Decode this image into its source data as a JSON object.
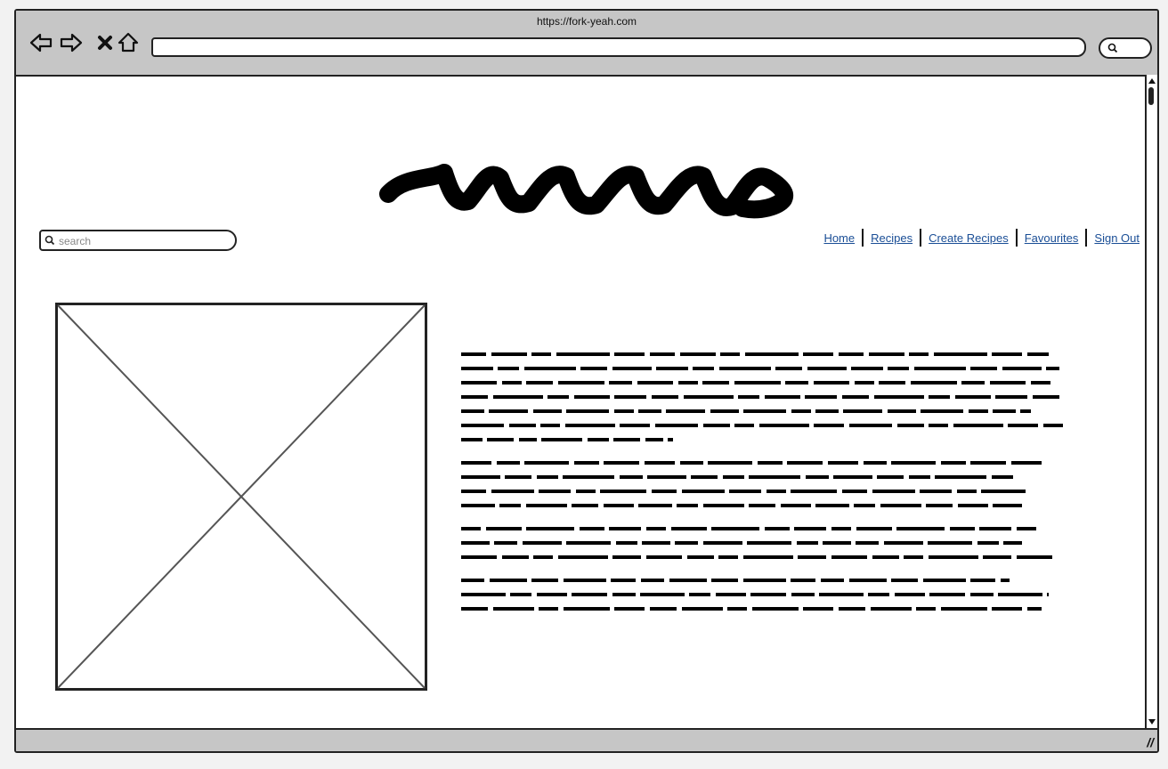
{
  "browser": {
    "url": "https://fork-yeah.com",
    "icons": [
      "back-icon",
      "forward-icon",
      "stop-icon",
      "home-icon",
      "search-icon"
    ]
  },
  "search": {
    "placeholder": "search"
  },
  "nav": {
    "items": [
      "Home",
      "Recipes",
      "Create Recipes",
      "Favourites",
      "Sign Out"
    ],
    "link_color": "#1a4e96"
  }
}
